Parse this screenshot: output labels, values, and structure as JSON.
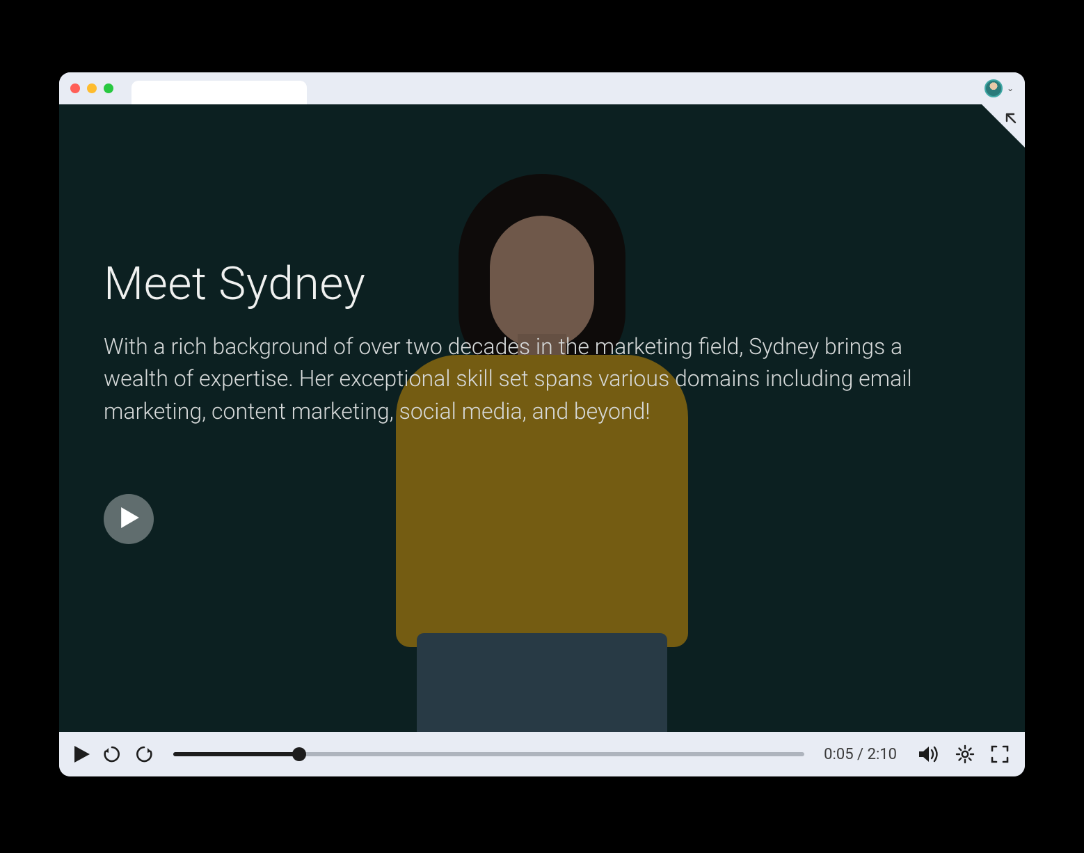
{
  "slide": {
    "heading": "Meet Sydney",
    "body": "With a rich background of over two decades in the marketing field, Sydney brings a wealth of expertise. Her exceptional skill set spans various domains including email marketing, content marketing, social media, and beyond!"
  },
  "player": {
    "current_time": "0:05",
    "duration": "2:10",
    "progress_percent": 20
  },
  "colors": {
    "content_bg": "#163b3c",
    "chrome_bg": "#e8ecf4",
    "sweater": "#d4a822"
  }
}
